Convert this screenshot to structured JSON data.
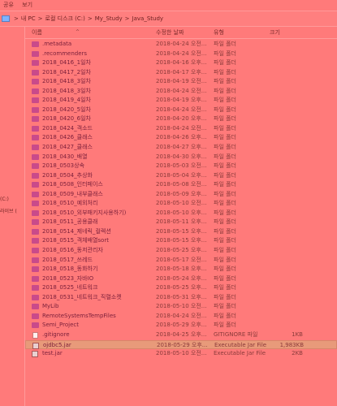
{
  "menu": [
    "공유",
    "보기"
  ],
  "address": {
    "path": [
      "내 PC",
      "로컬 디스크 (C:)",
      "My_Study",
      "Java_Study"
    ],
    "separator": ">"
  },
  "left_panel": {
    "item1": "(C:)",
    "item2": "라이브 ("
  },
  "columns": {
    "name": "이름",
    "date": "수정한 날짜",
    "type": "유형",
    "size": "크기"
  },
  "files": [
    {
      "name": ".metadata",
      "date": "2018-04-24 오전...",
      "type": "파일 폴더",
      "size": "",
      "kind": "folder"
    },
    {
      "name": ".recommenders",
      "date": "2018-04-24 오전...",
      "type": "파일 폴더",
      "size": "",
      "kind": "folder"
    },
    {
      "name": "2018_0416_1일차",
      "date": "2018-04-16 오후...",
      "type": "파일 폴더",
      "size": "",
      "kind": "folder"
    },
    {
      "name": "2018_0417_2일차",
      "date": "2018-04-17 오후...",
      "type": "파일 폴더",
      "size": "",
      "kind": "folder"
    },
    {
      "name": "2018_0418_3일차",
      "date": "2018-04-19 오전...",
      "type": "파일 폴더",
      "size": "",
      "kind": "folder"
    },
    {
      "name": "2018_0418_3일차",
      "date": "2018-04-24 오전...",
      "type": "파일 폴더",
      "size": "",
      "kind": "folder"
    },
    {
      "name": "2018_0419_4일차",
      "date": "2018-04-19 오후...",
      "type": "파일 폴더",
      "size": "",
      "kind": "folder"
    },
    {
      "name": "2018_0420_5일차",
      "date": "2018-04-24 오전...",
      "type": "파일 폴더",
      "size": "",
      "kind": "folder"
    },
    {
      "name": "2018_0420_6일차",
      "date": "2018-04-20 오후...",
      "type": "파일 폴더",
      "size": "",
      "kind": "folder"
    },
    {
      "name": "2018_0424_객소드",
      "date": "2018-04-24 오전...",
      "type": "파일 폴더",
      "size": "",
      "kind": "folder"
    },
    {
      "name": "2018_0426_클래스",
      "date": "2018-04-26 오후...",
      "type": "파일 폴더",
      "size": "",
      "kind": "folder"
    },
    {
      "name": "2018_0427_클래스",
      "date": "2018-04-27 오후...",
      "type": "파일 폴더",
      "size": "",
      "kind": "folder"
    },
    {
      "name": "2018_0430_배열",
      "date": "2018-04-30 오후...",
      "type": "파일 폴더",
      "size": "",
      "kind": "folder"
    },
    {
      "name": "2018_0503상속",
      "date": "2018-05-03 오전...",
      "type": "파일 폴더",
      "size": "",
      "kind": "folder"
    },
    {
      "name": "2018_0504_추상화",
      "date": "2018-05-04 오후...",
      "type": "파일 폴더",
      "size": "",
      "kind": "folder"
    },
    {
      "name": "2018_0508_인터페이스",
      "date": "2018-05-08 오전...",
      "type": "파일 폴더",
      "size": "",
      "kind": "folder"
    },
    {
      "name": "2018_0509_내부클래스",
      "date": "2018-05-09 오후...",
      "type": "파일 폴더",
      "size": "",
      "kind": "folder"
    },
    {
      "name": "2018_0510_예외처리",
      "date": "2018-05-10 오전...",
      "type": "파일 폴더",
      "size": "",
      "kind": "folder"
    },
    {
      "name": "2018_0510_외부패키지사용하기)",
      "date": "2018-05-10 오후...",
      "type": "파일 폴더",
      "size": "",
      "kind": "folder"
    },
    {
      "name": "2018_0511_공용클래",
      "date": "2018-05-11 오후...",
      "type": "파일 폴더",
      "size": "",
      "kind": "folder"
    },
    {
      "name": "2018_0514_제네릭_컬렉션",
      "date": "2018-05-15 오후...",
      "type": "파일 폴더",
      "size": "",
      "kind": "folder"
    },
    {
      "name": "2018_0515_객체배열sort",
      "date": "2018-05-15 오후...",
      "type": "파일 폴더",
      "size": "",
      "kind": "folder"
    },
    {
      "name": "2018_0516_동저관리자",
      "date": "2018-05-25 오후...",
      "type": "파일 폴더",
      "size": "",
      "kind": "folder"
    },
    {
      "name": "2018_0517_쓰레드",
      "date": "2018-05-17 오전...",
      "type": "파일 폴더",
      "size": "",
      "kind": "folder"
    },
    {
      "name": "2018_0518_동화하기",
      "date": "2018-05-18 오후...",
      "type": "파일 폴더",
      "size": "",
      "kind": "folder"
    },
    {
      "name": "2018_0523_자바IO",
      "date": "2018-05-24 오후...",
      "type": "파일 폴더",
      "size": "",
      "kind": "folder"
    },
    {
      "name": "2018_0525_네트워크",
      "date": "2018-05-25 오후...",
      "type": "파일 폴더",
      "size": "",
      "kind": "folder"
    },
    {
      "name": "2018_0531_네트워크_직렬소켓",
      "date": "2018-05-31 오후...",
      "type": "파일 폴더",
      "size": "",
      "kind": "folder"
    },
    {
      "name": "MyLib",
      "date": "2018-05-10 오전...",
      "type": "파일 폴더",
      "size": "",
      "kind": "folder"
    },
    {
      "name": "RemoteSystemsTempFiles",
      "date": "2018-04-24 오전...",
      "type": "파일 폴더",
      "size": "",
      "kind": "folder"
    },
    {
      "name": "Semi_Project",
      "date": "2018-05-29 오후...",
      "type": "파일 폴더",
      "size": "",
      "kind": "folder"
    },
    {
      "name": ".gitignore",
      "date": "2018-04-25 오후...",
      "type": "GITIGNORE 파일",
      "size": "1KB",
      "kind": "file"
    },
    {
      "name": "ojdbc5.jar",
      "date": "2018-05-29 오후...",
      "type": "Executable Jar File",
      "size": "1,983KB",
      "kind": "jar",
      "selected": true
    },
    {
      "name": "test.jar",
      "date": "2018-05-10 오전...",
      "type": "Executable Jar File",
      "size": "2KB",
      "kind": "jar"
    }
  ]
}
